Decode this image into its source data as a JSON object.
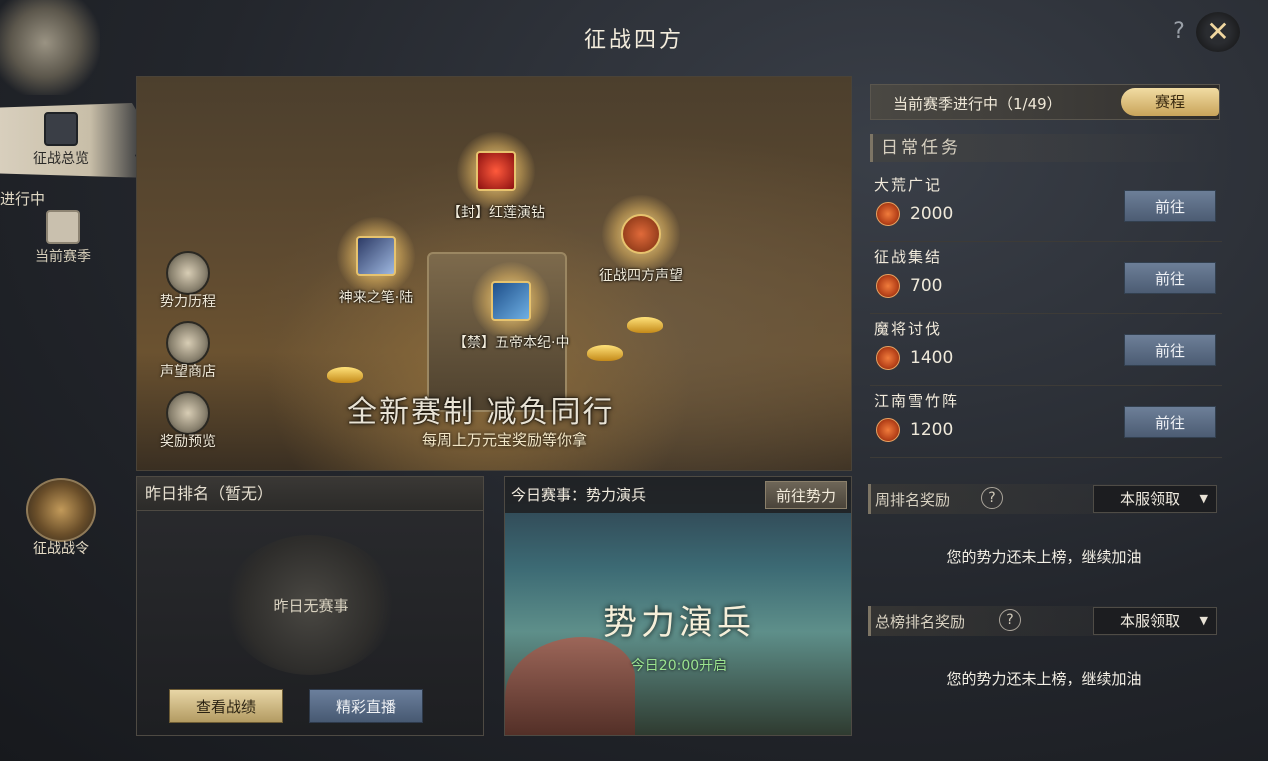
{
  "title": "征战四方",
  "controls": {
    "help_label": "?",
    "close_label": "✕"
  },
  "left_nav": {
    "overview_label": "征战总览",
    "in_progress_label": "进行中",
    "current_season_label": "当前赛季",
    "war_token_label": "征战战令"
  },
  "banner": {
    "rewards": [
      {
        "name": "【封】红莲演钻",
        "icon": "red-gem-icon"
      },
      {
        "name": "神来之笔·陆",
        "icon": "brush-icon"
      },
      {
        "name": "征战四方声望",
        "icon": "crossed-swords-icon"
      },
      {
        "name": "【禁】五帝本纪·中",
        "icon": "book-icon"
      }
    ],
    "side_buttons": [
      "势力历程",
      "声望商店",
      "奖励预览"
    ],
    "slogan": "全新赛制 减负同行",
    "sub_slogan": "每周上万元宝奖励等你拿"
  },
  "yesterday": {
    "header": "昨日排名（暂无）",
    "emblem_text": "昨日无赛事",
    "view_record_label": "查看战绩",
    "live_label": "精彩直播"
  },
  "today": {
    "header": "今日赛事：势力演兵",
    "goto_label": "前往势力",
    "event_name": "势力演兵",
    "event_time": "今日20:00开启"
  },
  "season": {
    "status": "当前赛季进行中（1/49）",
    "schedule_label": "赛程"
  },
  "daily": {
    "header": "日常任务",
    "tasks": [
      {
        "name": "大荒广记",
        "points": "2000",
        "go_label": "前往"
      },
      {
        "name": "征战集结",
        "points": "700",
        "go_label": "前往"
      },
      {
        "name": "魔将讨伐",
        "points": "1400",
        "go_label": "前往"
      },
      {
        "name": "江南雪竹阵",
        "points": "1200",
        "go_label": "前往"
      }
    ]
  },
  "weekly_rank": {
    "label": "周排名奖励",
    "help": "?",
    "dropdown_value": "本服领取",
    "message": "您的势力还未上榜，继续加油"
  },
  "total_rank": {
    "label": "总榜排名奖励",
    "help": "?",
    "dropdown_value": "本服领取",
    "message": "您的势力还未上榜，继续加油"
  },
  "colors": {
    "accent_gold": "#c9a45a",
    "button_blue": "#4c5c73",
    "time_green": "#9be38f",
    "coin_orange": "#f07c3c"
  }
}
